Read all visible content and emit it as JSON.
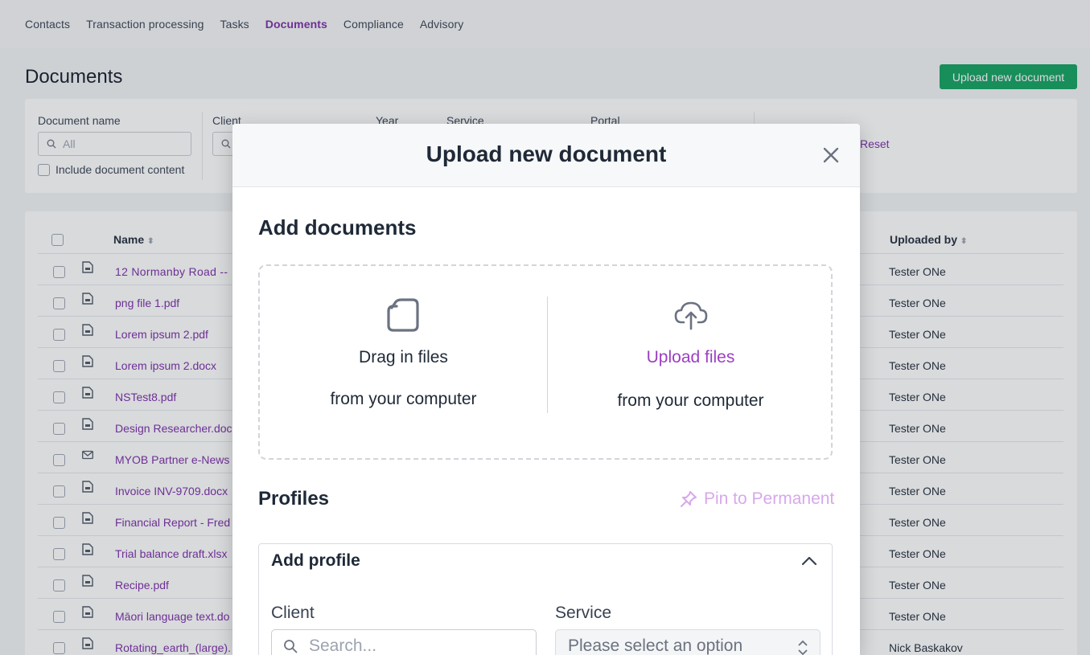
{
  "nav": {
    "items": [
      "Contacts",
      "Transaction processing",
      "Tasks",
      "Documents",
      "Compliance",
      "Advisory"
    ],
    "active": "Documents"
  },
  "page": {
    "title": "Documents",
    "upload_button": "Upload new document"
  },
  "filters": {
    "document_name_label": "Document name",
    "document_name_placeholder": "All",
    "include_content_label": "Include document content",
    "client_label": "Client",
    "year_label": "Year",
    "service_label": "Service",
    "portal_label": "Portal",
    "reset_label": "Reset"
  },
  "table": {
    "columns": {
      "name": "Name",
      "uploaded_by": "Uploaded by"
    },
    "rows": [
      {
        "name": "12 Normanby Road --",
        "icon": "document-icon",
        "uploaded_by": "Tester ONe"
      },
      {
        "name": "png file 1.pdf",
        "icon": "document-icon",
        "uploaded_by": "Tester ONe"
      },
      {
        "name": "Lorem ipsum 2.pdf",
        "icon": "document-icon",
        "uploaded_by": "Tester ONe"
      },
      {
        "name": "Lorem ipsum 2.docx",
        "icon": "document-icon",
        "uploaded_by": "Tester ONe"
      },
      {
        "name": "NSTest8.pdf",
        "icon": "document-icon",
        "uploaded_by": "Tester ONe"
      },
      {
        "name": "Design Researcher.doc",
        "icon": "document-icon",
        "uploaded_by": "Tester ONe"
      },
      {
        "name": "MYOB Partner e-News",
        "icon": "envelope-icon",
        "uploaded_by": "Tester ONe"
      },
      {
        "name": "Invoice INV-9709.docx",
        "icon": "document-icon",
        "uploaded_by": "Tester ONe"
      },
      {
        "name": "Financial Report - Fred",
        "icon": "document-icon",
        "uploaded_by": "Tester ONe"
      },
      {
        "name": "Trial balance draft.xlsx",
        "icon": "document-icon",
        "uploaded_by": "Tester ONe"
      },
      {
        "name": "Recipe.pdf",
        "icon": "document-icon",
        "uploaded_by": "Tester ONe"
      },
      {
        "name": "Māori language text.do",
        "icon": "document-icon",
        "uploaded_by": "Tester ONe"
      },
      {
        "name": "Rotating_earth_(large).",
        "icon": "document-icon",
        "uploaded_by": "Nick Baskakov"
      }
    ]
  },
  "modal": {
    "title": "Upload new document",
    "add_documents_heading": "Add documents",
    "drag_main": "Drag in files",
    "drag_sub": "from your computer",
    "upload_main": "Upload files",
    "upload_sub": "from your computer",
    "profiles_heading": "Profiles",
    "pin_label": "Pin to Permanent",
    "add_profile_heading": "Add profile",
    "client_label": "Client",
    "client_placeholder": "Search...",
    "service_label": "Service",
    "service_value": "Please select an option"
  },
  "colors": {
    "accent_purple": "#7b2aa6",
    "upload_green": "#10a05e"
  }
}
